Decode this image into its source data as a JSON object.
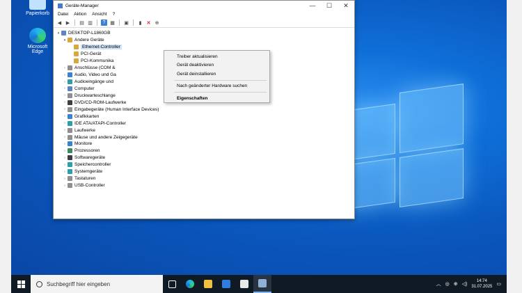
{
  "desktop": {
    "icons": [
      {
        "label": "Papierkorb",
        "icon": "recycle-bin-icon"
      },
      {
        "label": "Microsoft Edge",
        "icon": "edge-icon"
      }
    ]
  },
  "window": {
    "title": "Geräte-Manager",
    "controls": {
      "minimize": "—",
      "maximize": "☐",
      "close": "✕"
    },
    "menu": [
      "Datei",
      "Aktion",
      "Ansicht",
      "?"
    ],
    "tree": {
      "root": "DESKTOP-L1860GB",
      "other_devices": "Andere Geräte",
      "other_children": [
        "Ethernet-Controller",
        "PCI-Gerät",
        "PCI-Kommunika"
      ],
      "categories": [
        "Anschlüsse (COM &",
        "Audio, Video und Ga",
        "Audioeingänge und",
        "Computer",
        "Druckwarteschlange",
        "DVD/CD-ROM-Laufwerke",
        "Eingabegeräte (Human Interface Devices)",
        "Grafikkarten",
        "IDE ATA/ATAPI-Controller",
        "Laufwerke",
        "Mäuse und andere Zeigegeräte",
        "Monitore",
        "Prozessoren",
        "Softwaregeräte",
        "Speichercontroller",
        "Systemgeräte",
        "Tastaturen",
        "USB-Controller"
      ]
    }
  },
  "context_menu": {
    "items": [
      "Treiber aktualisieren",
      "Gerät deaktivieren",
      "Gerät deinstallieren",
      "Nach geänderter Hardware suchen",
      "Eigenschaften"
    ]
  },
  "taskbar": {
    "search_placeholder": "Suchbegriff hier eingeben",
    "time": "14:74",
    "date": "31.07.2025"
  }
}
